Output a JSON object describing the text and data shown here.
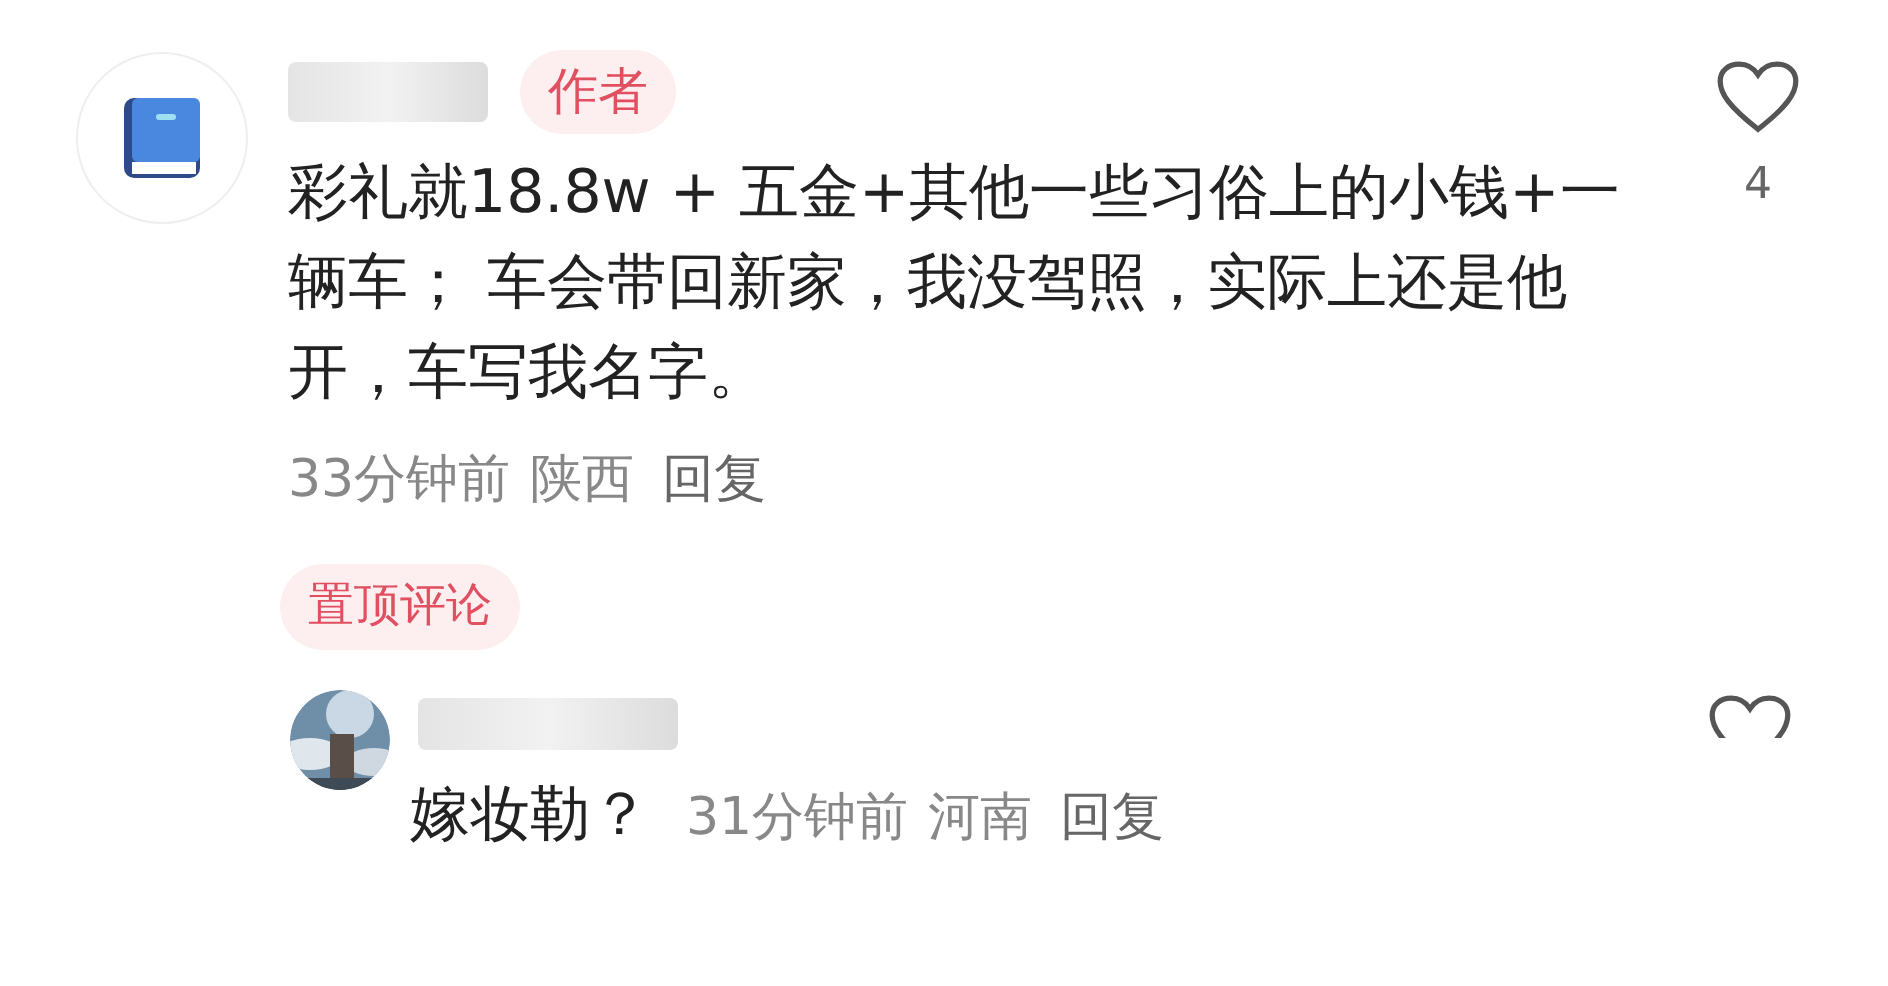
{
  "comment": {
    "name_redacted": true,
    "badge": "作者",
    "text": "彩礼就18.8w  + 五金+其他一些习俗上的小钱+一辆车；  车会带回新家，我没驾照，实际上还是他开，车写我名字。",
    "time": "33分钟前",
    "location": "陕西",
    "reply_label": "回复",
    "likes": "4",
    "liked": false,
    "pinned_label": "置顶评论"
  },
  "reply": {
    "name_redacted": true,
    "text": "嫁妆勒？",
    "time": "31分钟前",
    "location": "河南",
    "reply_label": "回复",
    "liked": false
  }
}
